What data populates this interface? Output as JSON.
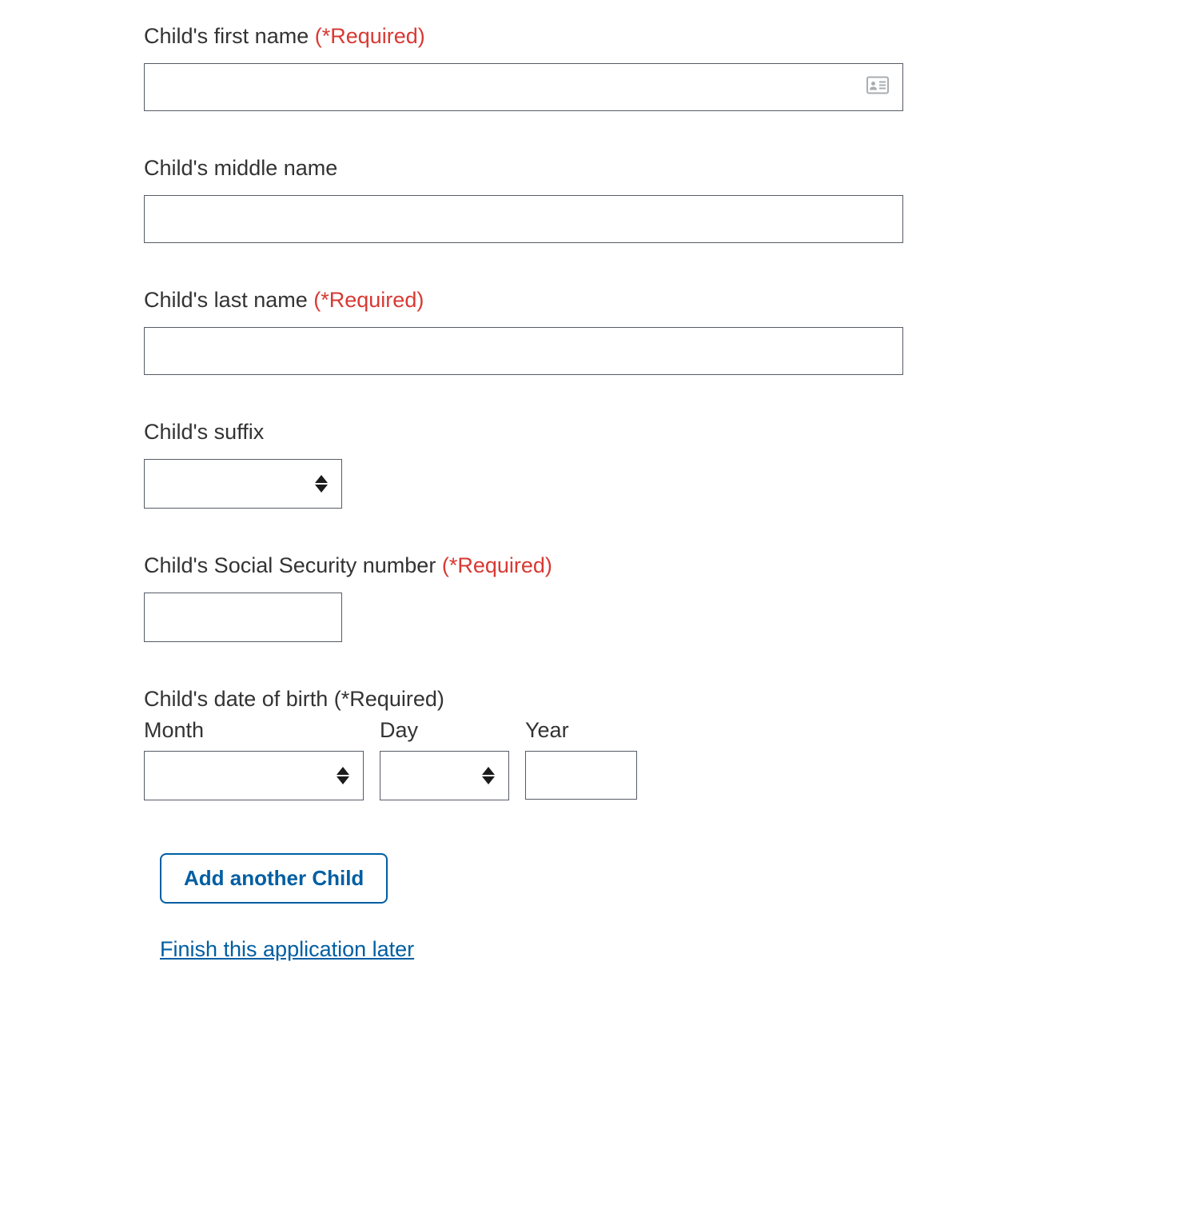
{
  "labels": {
    "first_name": "Child's first name",
    "middle_name": "Child's middle name",
    "last_name": "Child's last name",
    "suffix": "Child's suffix",
    "ssn": "Child's Social Security number",
    "dob": "Child's date of birth",
    "month": "Month",
    "day": "Day",
    "year": "Year",
    "required": "(*Required)"
  },
  "values": {
    "first_name": "",
    "middle_name": "",
    "last_name": "",
    "suffix": "",
    "ssn": "",
    "month": "",
    "day": "",
    "year": ""
  },
  "actions": {
    "add_child": "Add another Child",
    "finish_later": "Finish this application later"
  }
}
